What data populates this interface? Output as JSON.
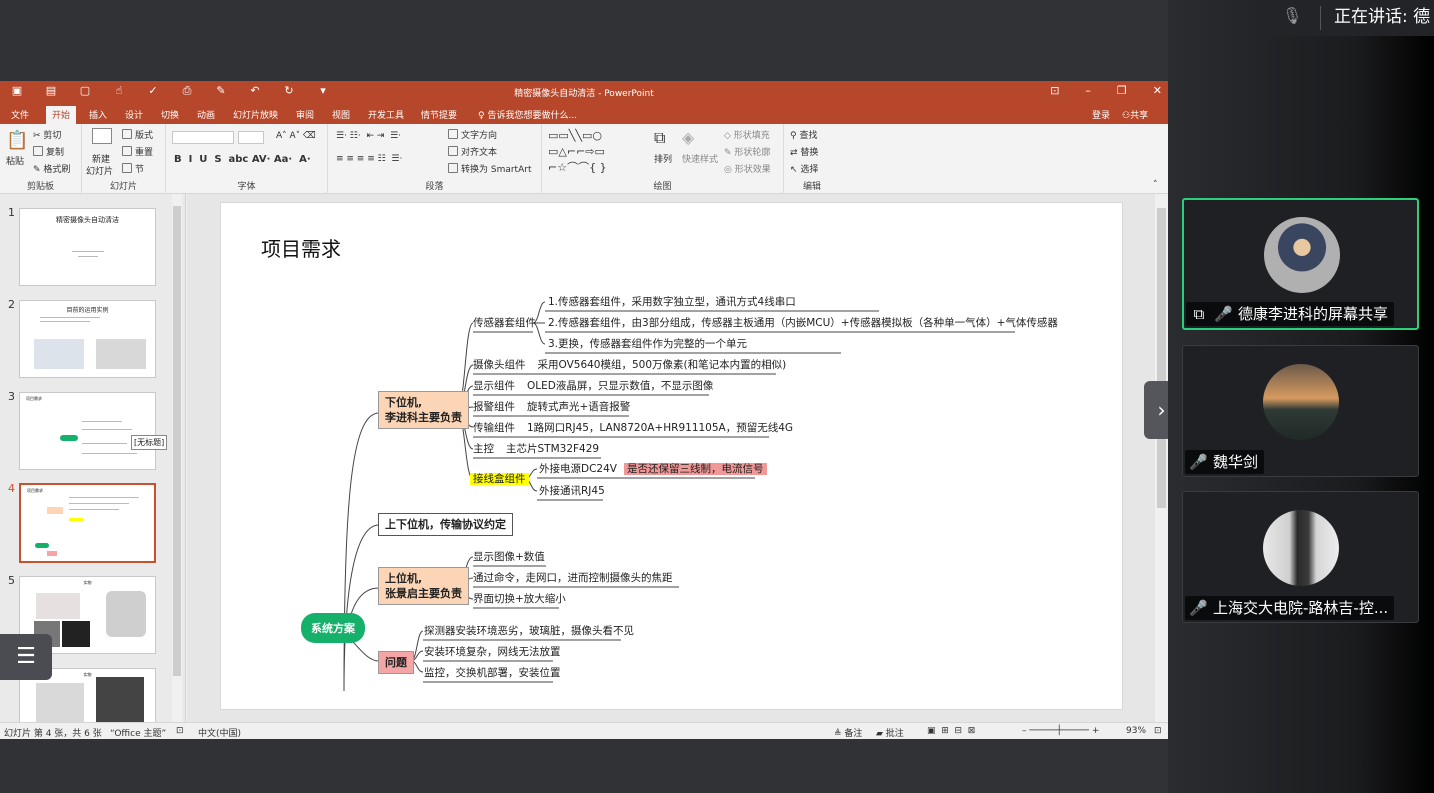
{
  "ppt": {
    "doc_title": "精密摄像头自动清洁 - PowerPoint",
    "tabs": [
      "文件",
      "开始",
      "插入",
      "设计",
      "切换",
      "动画",
      "幻灯片放映",
      "审阅",
      "视图",
      "开发工具",
      "情节提要"
    ],
    "tell_me": "告诉我您想要做什么...",
    "login": "登录",
    "share": "共享",
    "ribbon": {
      "clipboard": {
        "paste": "粘贴",
        "cut": "剪切",
        "copy": "复制",
        "format_painter": "格式刷",
        "label": "剪贴板"
      },
      "slides": {
        "new_slide": "新建",
        "new_slide2": "幻灯片",
        "layout": "版式",
        "reset": "重置",
        "section": "节",
        "label": "幻灯片"
      },
      "font": {
        "label": "字体"
      },
      "paragraph": {
        "text_direction": "文字方向",
        "align_text": "对齐文本",
        "smartart": "转换为 SmartArt",
        "label": "段落"
      },
      "drawing": {
        "arrange": "排列",
        "quick_styles": "快速样式",
        "shape_fill": "形状填充",
        "shape_outline": "形状轮廓",
        "shape_effects": "形状效果",
        "label": "绘图"
      },
      "editing": {
        "find": "查找",
        "replace": "替换",
        "select": "选择",
        "label": "编辑"
      }
    },
    "thumbnails": [
      {
        "num": "1",
        "title": "精密摄像头自动清洁"
      },
      {
        "num": "2",
        "title": "目前的运用实例"
      },
      {
        "num": "3",
        "title": "项目需求"
      },
      {
        "num": "4",
        "title": "项目需求"
      },
      {
        "num": "5",
        "title": "实物"
      },
      {
        "num": "6",
        "title": "实物"
      }
    ],
    "tooltip": "[无标题]",
    "status": {
      "slide_info": "幻灯片 第 4 张，共 6 张",
      "theme": "“Office 主题”",
      "lang": "中文(中国)",
      "notes": "备注",
      "comments": "批注",
      "zoom": "93%"
    },
    "slide": {
      "title": "项目需求",
      "root": "系统方案",
      "lower": {
        "label_1": "下位机,",
        "label_2": "李进科主要负责",
        "sensor": "传感器套组件",
        "sensor_items": [
          "1.传感器套组件，采用数字独立型，通讯方式4线串口",
          "2.传感器套组件，由3部分组成，传感器主板通用（内嵌MCU）+传感器模拟板（各种单一气体）+气体传感器",
          "3.更换，传感器套组件作为完整的一个单元"
        ],
        "camera": "摄像头组件",
        "camera_desc": "采用OV5640模组，500万像素(和笔记本内置的相似)",
        "display": "显示组件",
        "display_desc": "OLED液晶屏，只显示数值，不显示图像",
        "alarm": "报警组件",
        "alarm_desc": "旋转式声光+语音报警",
        "transfer": "传输组件",
        "transfer_desc": "1路网口RJ45，LAN8720A+HR911105A，预留无线4G",
        "mcu": "主控",
        "mcu_desc": "主芯片STM32F429",
        "junction": "接线盒组件",
        "junction_items": [
          "外接电源DC24V",
          "外接通讯RJ45"
        ],
        "junction_note": "是否还保留三线制，电流信号"
      },
      "protocol": "上下位机，传输协议约定",
      "upper": {
        "label_1": "上位机,",
        "label_2": "张景启主要负责",
        "items": [
          "显示图像+数值",
          "通过命令，走网口，进而控制摄像头的焦距",
          "界面切换+放大缩小"
        ]
      },
      "problem": {
        "label": "问题",
        "items": [
          "探测器安装环境恶劣，玻璃脏，摄像头看不见",
          "安装环境复杂，网线无法放置",
          "监控，交换机部署，安装位置"
        ]
      }
    }
  },
  "meeting": {
    "speaking_label": "正在讲话: 德",
    "participants": [
      {
        "name": "德康李进科的屏幕共享",
        "mic": "on"
      },
      {
        "name": "魏华剑",
        "mic": "muted"
      },
      {
        "name": "上海交大电院-路林吉-控...",
        "mic": "on"
      }
    ]
  }
}
